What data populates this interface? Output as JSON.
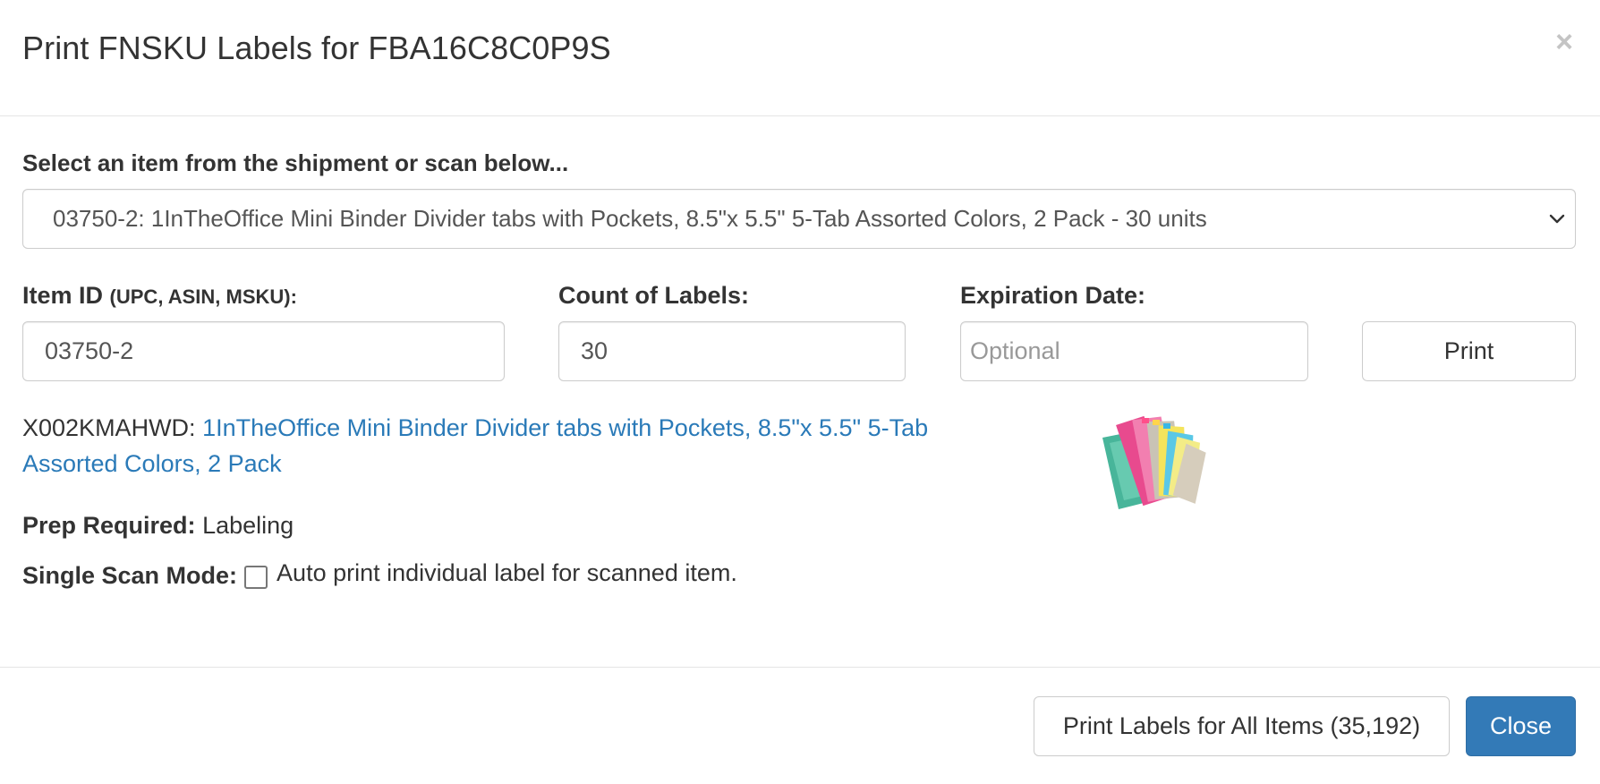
{
  "modal": {
    "title": "Print FNSKU Labels for FBA16C8C0P9S",
    "close_glyph": "×"
  },
  "selector": {
    "label": "Select an item from the shipment or scan below...",
    "selected_value": "03750-2: 1InTheOffice Mini Binder Divider tabs with Pockets, 8.5\"x 5.5\" 5-Tab Assorted Colors, 2 Pack - 30 units",
    "icon": "chevron-down-icon"
  },
  "form": {
    "item_id_label": "Item ID",
    "item_id_hint": "(UPC, ASIN, MSKU):",
    "item_id_value": "03750-2",
    "count_label": "Count of Labels:",
    "count_value": "30",
    "expiration_label": "Expiration Date:",
    "expiration_placeholder": "Optional",
    "print_button": "Print"
  },
  "product": {
    "fnsku": "X002KMAHWD:",
    "title": "1InTheOffice Mini Binder Divider tabs with Pockets, 8.5\"x 5.5\" 5-Tab Assorted Colors, 2 Pack",
    "prep_label": "Prep Required:",
    "prep_value": "Labeling",
    "scan_mode_label": "Single Scan Mode:",
    "scan_mode_text": "Auto print individual label for scanned item.",
    "scan_mode_checked": false
  },
  "footer": {
    "print_all_button": "Print Labels for All Items (35,192)",
    "close_button": "Close"
  },
  "colors": {
    "primary": "#337ab7",
    "link": "#2a7ab8",
    "border": "#cccccc"
  }
}
